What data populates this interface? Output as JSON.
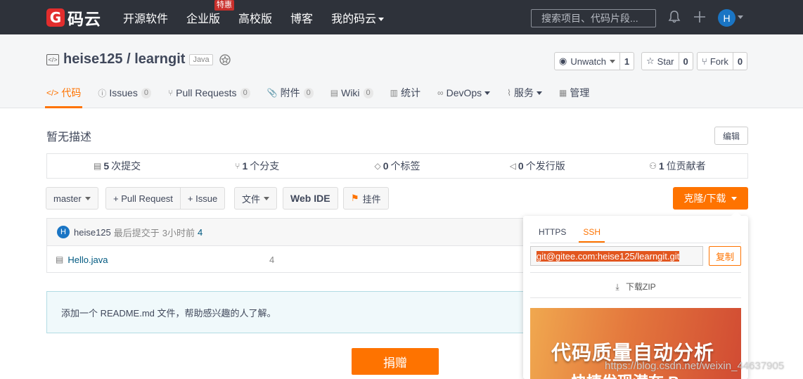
{
  "topnav": {
    "logo_mark": "G",
    "logo_text": "码云",
    "items": [
      {
        "label": "开源软件"
      },
      {
        "label": "企业版",
        "badge": "特惠"
      },
      {
        "label": "高校版"
      },
      {
        "label": "博客"
      },
      {
        "label": "我的码云"
      }
    ],
    "search_placeholder": "搜索项目、代码片段...",
    "avatar_letter": "H"
  },
  "repo": {
    "owner": "heise125",
    "separator": " / ",
    "name": "learngit",
    "language_tag": "Java",
    "watch": {
      "label": "Unwatch",
      "count": "1"
    },
    "star": {
      "label": "Star",
      "count": "0"
    },
    "fork": {
      "label": "Fork",
      "count": "0"
    }
  },
  "tabs": [
    {
      "label": "代码",
      "icon": "</>"
    },
    {
      "label": "Issues",
      "count": "0",
      "icon": "ⓘ"
    },
    {
      "label": "Pull Requests",
      "count": "0",
      "icon": "⑂"
    },
    {
      "label": "附件",
      "count": "0",
      "icon": "📎"
    },
    {
      "label": "Wiki",
      "count": "0",
      "icon": "▤"
    },
    {
      "label": "统计",
      "icon": "▥"
    },
    {
      "label": "DevOps",
      "icon": "∞"
    },
    {
      "label": "服务",
      "icon": "⌇"
    },
    {
      "label": "管理",
      "icon": "▦"
    }
  ],
  "description": "暂无描述",
  "edit_label": "编辑",
  "stats": [
    {
      "num": "5",
      "label": "次提交",
      "icon": "▤"
    },
    {
      "num": "1",
      "label": "个分支",
      "icon": "⑂"
    },
    {
      "num": "0",
      "label": "个标签",
      "icon": "◇"
    },
    {
      "num": "0",
      "label": "个发行版",
      "icon": "◁"
    },
    {
      "num": "1",
      "label": "位贡献者",
      "icon": "⚇"
    }
  ],
  "toolbar": {
    "branch": "master",
    "pull_request": "+ Pull Request",
    "issue": "+ Issue",
    "file": "文件",
    "web_ide": "Web IDE",
    "widget": "挂件",
    "clone": "克隆/下载"
  },
  "commit": {
    "avatar": "H",
    "author": "heise125",
    "text": "最后提交于",
    "time": "3小时前",
    "message": "4"
  },
  "files": [
    {
      "name": "Hello.java",
      "message": "4"
    }
  ],
  "readme_hint": "添加一个 README.md 文件，帮助感兴趣的人了解。",
  "donate": "捐赠",
  "clone_dropdown": {
    "tabs": [
      "HTTPS",
      "SSH"
    ],
    "url": "git@gitee.com:heise125/learngit.git",
    "copy": "复制",
    "zip": "下载ZIP",
    "banner_line1": "代码质量自动分析",
    "banner_line2": "快捷发现潜在 Bug"
  },
  "watermark": "https://blog.csdn.net/weixin_44637905",
  "colors": {
    "accent": "#fe7300",
    "nav_bg": "#2e323a",
    "link": "#005980"
  }
}
